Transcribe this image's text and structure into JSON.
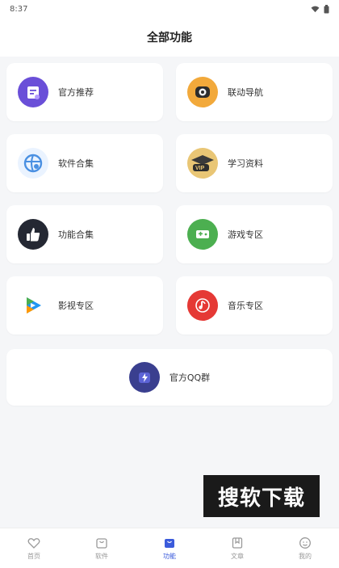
{
  "status_bar": {
    "time": "8:37"
  },
  "header": {
    "title": "全部功能"
  },
  "features": [
    {
      "label": "官方推荐",
      "icon": "recommend-icon"
    },
    {
      "label": "联动导航",
      "icon": "navigation-icon"
    },
    {
      "label": "软件合集",
      "icon": "software-icon"
    },
    {
      "label": "学习资料",
      "icon": "vip-study-icon"
    },
    {
      "label": "功能合集",
      "icon": "thumbs-up-icon"
    },
    {
      "label": "游戏专区",
      "icon": "gamepad-icon"
    },
    {
      "label": "影视专区",
      "icon": "video-play-icon"
    },
    {
      "label": "音乐专区",
      "icon": "music-note-icon"
    }
  ],
  "qq_group": {
    "label": "官方QQ群",
    "icon": "lightning-icon"
  },
  "watermark": "搜软下载",
  "bottom_nav": [
    {
      "label": "首页",
      "icon": "heart-icon"
    },
    {
      "label": "软件",
      "icon": "bag-icon"
    },
    {
      "label": "功能",
      "icon": "bag-icon"
    },
    {
      "label": "文章",
      "icon": "bookmark-icon"
    },
    {
      "label": "我的",
      "icon": "smile-icon"
    }
  ],
  "colors": {
    "accent": "#3b5bdb",
    "background": "#f5f6f8",
    "card": "#ffffff"
  }
}
